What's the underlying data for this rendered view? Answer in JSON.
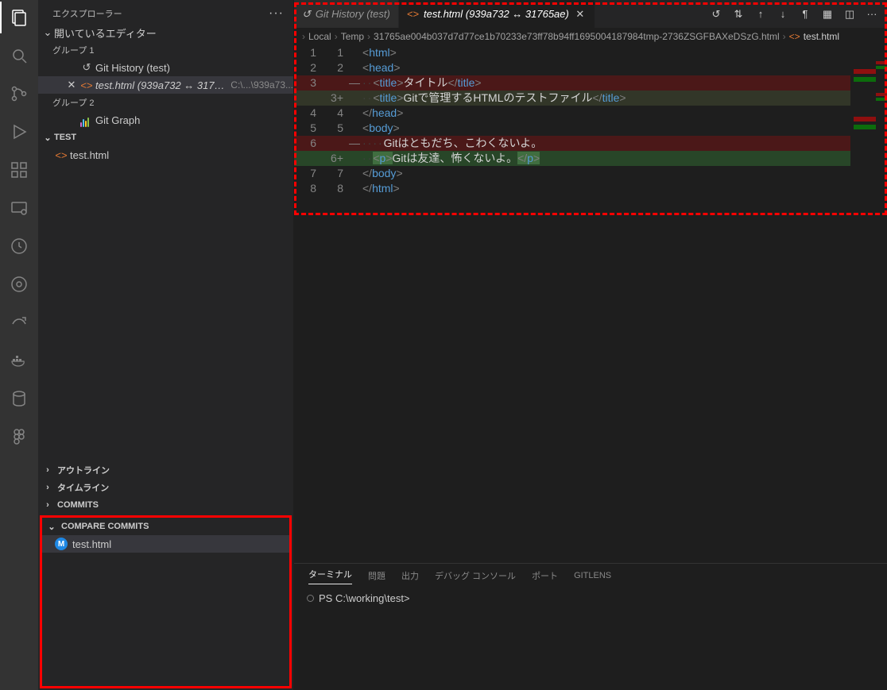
{
  "sidebar": {
    "title": "エクスプローラー",
    "open_editors": "開いているエディター",
    "group1": "グループ 1",
    "group2": "グループ 2",
    "git_history": "Git History (test)",
    "diff_file": "test.html (939a732 ↔ 31765ae)",
    "diff_path": "C:\\...\\939a73...",
    "git_graph": "Git Graph",
    "workspace": "TEST",
    "file1": "test.html",
    "outline": "アウトライン",
    "timeline": "タイムライン",
    "commits": "COMMITS",
    "compare": "COMPARE COMMITS",
    "compare_file": "test.html",
    "badge_m": "M"
  },
  "tabs": {
    "git_history": "Git History (test)",
    "diff": "test.html (939a732 ↔ 31765ae)"
  },
  "breadcrumb": {
    "seg1": "Local",
    "seg2": "Temp",
    "seg3": "31765ae004b037d7d77ce1b70233e73ff78b94ff1695004187984tmp-2736ZSGFBAXeDSzG.html",
    "file": "test.html"
  },
  "code": {
    "l1_left": "1",
    "l1_right": "1",
    "l1": "<html>",
    "l2_left": "2",
    "l2_right": "2",
    "l2": "<head>",
    "l3_left": "3",
    "l3_right_mark": "—",
    "l3_del_pre": "··",
    "l3_del_tag_open": "<title>",
    "l3_del_txt": "タイトル",
    "l3_del_tag_close": "</title>",
    "l3b_right": "3+",
    "l3_add_pre": "··",
    "l3_add_tag_open": "<title>",
    "l3_add_txt": "Gitで管理するHTMLのテストファイル",
    "l3_add_tag_close": "</title>",
    "l4_left": "4",
    "l4_right": "4",
    "l4": "</head>",
    "l5_left": "5",
    "l5_right": "5",
    "l5": "<body>",
    "l6_left": "6",
    "l6_right_mark": "—",
    "l6_del_pre": "····",
    "l6_del_txt": "Gitはともだち、こわくないよ。",
    "l6b_right": "6+",
    "l6_add_pre": "··",
    "l6_add_open": "<p>",
    "l6_add_txt": "Gitは友達、怖くないよ。",
    "l6_add_close": "</p>",
    "l7_left": "7",
    "l7_right": "7",
    "l7": "</body>",
    "l8_left": "8",
    "l8_right": "8",
    "l8": "</html>"
  },
  "terminal": {
    "tab_terminal": "ターミナル",
    "tab_problems": "問題",
    "tab_output": "出力",
    "tab_debug": "デバッグ コンソール",
    "tab_ports": "ポート",
    "tab_gitlens": "GITLENS",
    "prompt": "PS C:\\working\\test>"
  }
}
